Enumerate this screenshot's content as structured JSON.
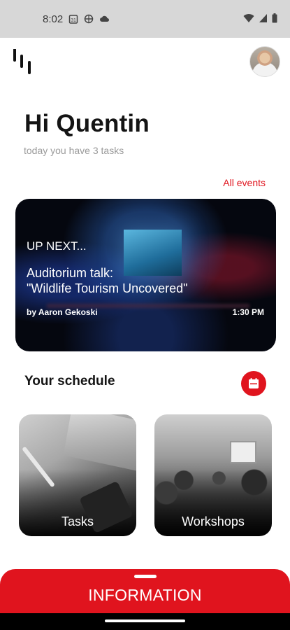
{
  "status_bar": {
    "time": "8:02",
    "icons": [
      "calendar-icon",
      "vpn-icon",
      "cloud-icon",
      "wifi-icon",
      "signal-icon",
      "battery-icon"
    ]
  },
  "header": {
    "logo": "app-logo-icon",
    "avatar": "user-avatar"
  },
  "greeting": {
    "title": "Hi Quentin",
    "subtitle": "today you have 3 tasks"
  },
  "events_link": "All events",
  "up_next": {
    "label": "UP NEXT...",
    "title_line1": "Auditorium talk:",
    "title_line2": "\"Wildlife Tourism Uncovered\"",
    "speaker": "by Aaron Gekoski",
    "time": "1:30 PM"
  },
  "schedule": {
    "title": "Your schedule",
    "calendar_icon": "calendar-icon",
    "tiles": [
      {
        "label": "Tasks"
      },
      {
        "label": "Workshops"
      }
    ]
  },
  "information": {
    "label": "INFORMATION"
  },
  "colors": {
    "accent": "#e0141e",
    "status_bar": "#d7d7d7",
    "subtitle": "#9a9a9a"
  }
}
